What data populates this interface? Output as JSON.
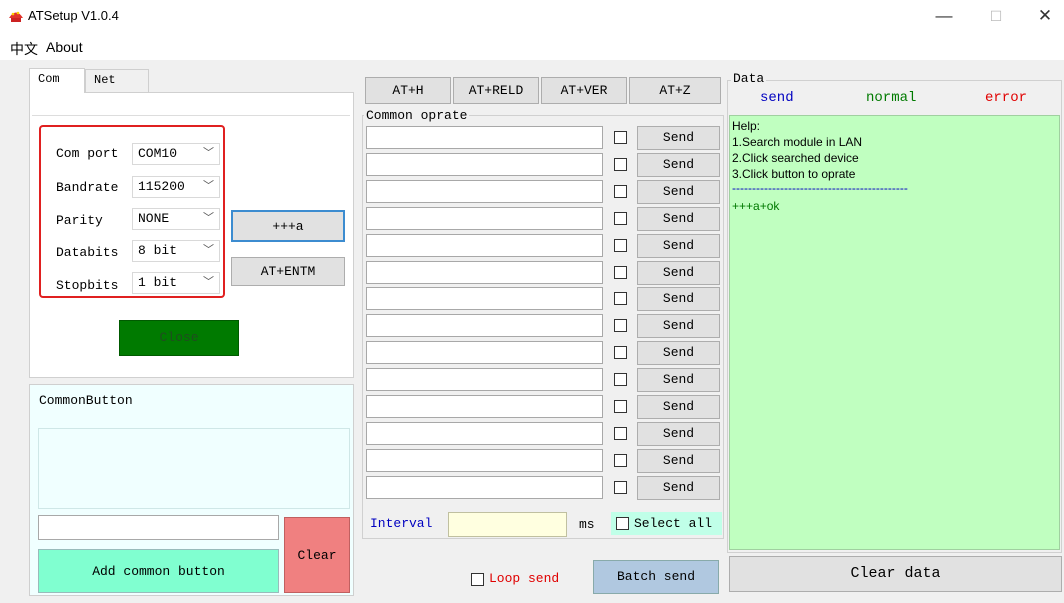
{
  "window": {
    "title": "ATSetup V1.0.4",
    "controls": [
      "—",
      "☐",
      "✕"
    ]
  },
  "menu": [
    "中文",
    "About"
  ],
  "left": {
    "tabs": [
      "Com",
      "Net"
    ],
    "com": {
      "fields": [
        {
          "label": "Com port",
          "value": "COM10"
        },
        {
          "label": "Bandrate",
          "value": "115200"
        },
        {
          "label": "Parity",
          "value": "NONE"
        },
        {
          "label": "Databits",
          "value": "8 bit"
        },
        {
          "label": "Stopbits",
          "value": "1 bit"
        }
      ],
      "buttons": [
        "+++a",
        "AT+ENTM"
      ],
      "close_label": "Close",
      "close_color": "#007a00"
    },
    "common_button": {
      "group_label": "CommonButton",
      "name_value": "",
      "add_label": "Add common button",
      "clear_label": "Clear",
      "add_color": "#80ffd0",
      "clear_color": "#f08080"
    }
  },
  "middle": {
    "at_buttons": [
      "AT+H",
      "AT+RELD",
      "AT+VER",
      "AT+Z"
    ],
    "common_oprate_label": "Common oprate",
    "rows": [
      {
        "value": "",
        "checked": false,
        "send": "Send"
      },
      {
        "value": "",
        "checked": false,
        "send": "Send"
      },
      {
        "value": "",
        "checked": false,
        "send": "Send"
      },
      {
        "value": "",
        "checked": false,
        "send": "Send"
      },
      {
        "value": "",
        "checked": false,
        "send": "Send"
      },
      {
        "value": "",
        "checked": false,
        "send": "Send"
      },
      {
        "value": "",
        "checked": false,
        "send": "Send"
      },
      {
        "value": "",
        "checked": false,
        "send": "Send"
      },
      {
        "value": "",
        "checked": false,
        "send": "Send"
      },
      {
        "value": "",
        "checked": false,
        "send": "Send"
      },
      {
        "value": "",
        "checked": false,
        "send": "Send"
      },
      {
        "value": "",
        "checked": false,
        "send": "Send"
      },
      {
        "value": "",
        "checked": false,
        "send": "Send"
      },
      {
        "value": "",
        "checked": false,
        "send": "Send"
      }
    ],
    "interval_label": "Interval",
    "interval_value": "",
    "ms_label": "ms",
    "select_all_label": "Select all",
    "loop_send_label": "Loop send",
    "batch_send_label": "Batch send",
    "interval_color": "#0000c0",
    "loop_color": "#e00000",
    "batch_bg": "#b0c8e0",
    "select_all_bg": "#c0ffe8"
  },
  "right": {
    "group_label": "Data",
    "legend": [
      {
        "text": "send",
        "color": "#0000c0"
      },
      {
        "text": "normal",
        "color": "#007a00"
      },
      {
        "text": "error",
        "color": "#e00000"
      }
    ],
    "help_lines": [
      "Help:",
      "1.Search module in LAN",
      "2.Click searched device",
      "3.Click button to oprate"
    ],
    "separator": "--------------------------------------------",
    "log_lines": [
      "+++a+ok"
    ],
    "clear_data_label": "Clear data"
  }
}
